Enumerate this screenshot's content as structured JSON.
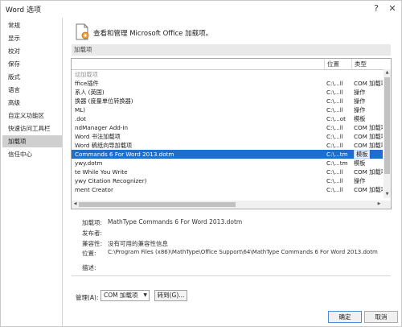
{
  "window": {
    "title": "Word 选项",
    "help_glyph": "?",
    "close_glyph": "✕"
  },
  "sidebar": {
    "items": [
      {
        "label": "常规"
      },
      {
        "label": "显示"
      },
      {
        "label": "校对"
      },
      {
        "label": "保存"
      },
      {
        "label": "版式"
      },
      {
        "label": "语言"
      },
      {
        "label": "高级"
      },
      {
        "label": "自定义功能区"
      },
      {
        "label": "快速访问工具栏"
      },
      {
        "label": "加载项",
        "selected": true
      },
      {
        "label": "信任中心"
      }
    ]
  },
  "header": {
    "text": "查看和管理 Microsoft Office 加载项。",
    "icon": "gear-document-icon"
  },
  "section": {
    "label": "加载项"
  },
  "table": {
    "columns": {
      "name": "",
      "location": "位置",
      "type": "类型"
    },
    "rows": [
      {
        "name": "动加载项",
        "location": "",
        "type": "",
        "group": true
      },
      {
        "name": "ffice插件",
        "location": "C:\\...ll",
        "type": "COM 加载项"
      },
      {
        "name": "系人 (英国)",
        "location": "C:\\...ll",
        "type": "操作"
      },
      {
        "name": "换器 (度量单位转换器)",
        "location": "C:\\...ll",
        "type": "操作"
      },
      {
        "name": "ML)",
        "location": "C:\\...ll",
        "type": "操作"
      },
      {
        "name": ".dot",
        "location": "C:\\...ot",
        "type": "模板"
      },
      {
        "name": "ndManager Add-In",
        "location": "C:\\...ll",
        "type": "COM 加载项"
      },
      {
        "name": "Word 书法加载项",
        "location": "C:\\...ll",
        "type": "COM 加载项"
      },
      {
        "name": "Word 稿纸向导加载项",
        "location": "C:\\...ll",
        "type": "COM 加载项"
      },
      {
        "name": "Commands 6 For Word 2013.dotm",
        "location": "C:\\...tm",
        "type": "模板",
        "selected": true
      },
      {
        "name": "ywy.dotm",
        "location": "C:\\...tm",
        "type": "模板"
      },
      {
        "name": "te While You Write",
        "location": "C:\\...ll",
        "type": "COM 加载项"
      },
      {
        "name": "ywy Citation Recognizer)",
        "location": "C:\\...ll",
        "type": "操作"
      },
      {
        "name": "ment Creator",
        "location": "C:\\...ll",
        "type": "COM 加载项"
      }
    ]
  },
  "details": {
    "addin_label": "加载项:",
    "addin_value": "MathType Commands 6 For Word 2013.dotm",
    "publisher_label": "发布者:",
    "publisher_value": "",
    "compat_label": "兼容性:",
    "compat_value": "没有可用的兼容性信息",
    "location_label": "位置:",
    "location_value": "C:\\Program Files (x86)\\MathType\\Office Support\\64\\MathType Commands 6 For Word 2013.dotm",
    "desc_label": "描述:"
  },
  "manage": {
    "label": "管理(A):",
    "selected_option": "COM 加载项",
    "go_label": "转到(G)..."
  },
  "footer": {
    "ok_label": "确定",
    "cancel_label": "取消"
  }
}
